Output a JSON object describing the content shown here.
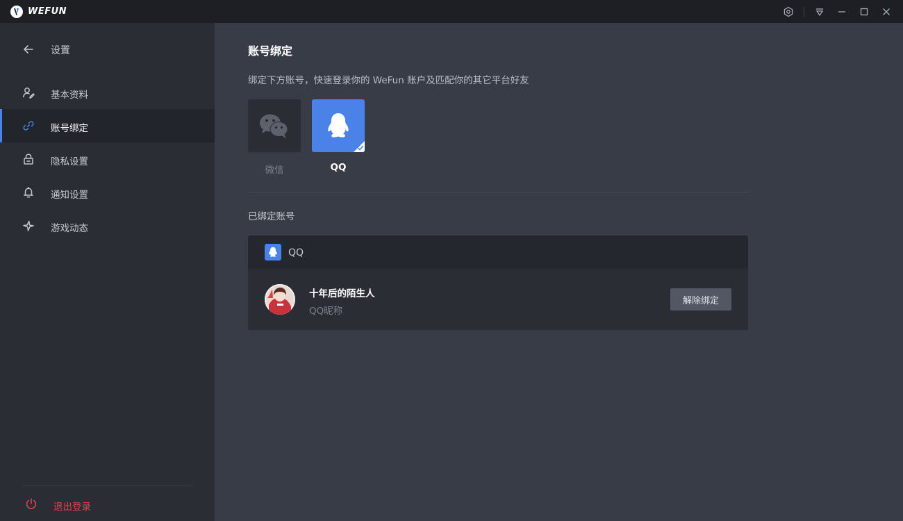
{
  "app": {
    "logo_text": "WEFUN"
  },
  "titlebar": {
    "controls": [
      "hexagon-icon",
      "dropdown-icon",
      "minimize-icon",
      "maximize-icon",
      "close-icon"
    ]
  },
  "sidebar": {
    "back_label": "设置",
    "items": [
      {
        "label": "基本资料",
        "icon": "profile-edit-icon",
        "active": false
      },
      {
        "label": "账号绑定",
        "icon": "link-icon",
        "active": true
      },
      {
        "label": "隐私设置",
        "icon": "lock-icon",
        "active": false
      },
      {
        "label": "通知设置",
        "icon": "bell-icon",
        "active": false
      },
      {
        "label": "游戏动态",
        "icon": "game-activity-icon",
        "active": false
      }
    ],
    "logout_label": "退出登录"
  },
  "main": {
    "title": "账号绑定",
    "subtitle": "绑定下方账号，快速登录你的 WeFun 账户及匹配你的其它平台好友",
    "platforms": [
      {
        "label": "微信",
        "icon": "wechat-icon",
        "bound": false
      },
      {
        "label": "QQ",
        "icon": "qq-icon",
        "bound": true
      }
    ],
    "bound_section_label": "已绑定账号",
    "bound_account": {
      "platform": "QQ",
      "nickname": "十年后的陌生人",
      "nickname_caption": "QQ昵称",
      "unbind_label": "解除绑定"
    }
  },
  "colors": {
    "accent": "#4a82e8",
    "danger": "#e0434d",
    "sidebar_bg": "#2a2d34",
    "main_bg": "#383c46",
    "titlebar_bg": "#1d1f25"
  }
}
